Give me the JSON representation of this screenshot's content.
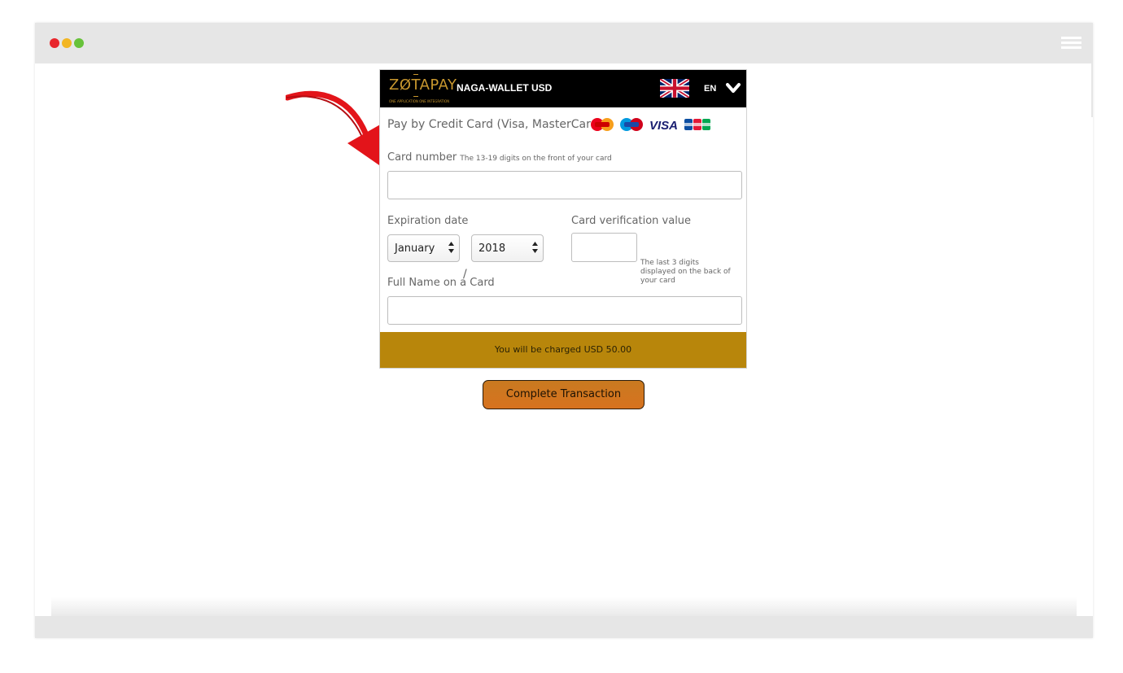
{
  "brand": {
    "logo_text": "ZØTAPAY",
    "logo_tagline": "ONE APPLICATION ONE INTEGRATION",
    "merchant": "NAGA-WALLET USD",
    "language": "EN"
  },
  "payment": {
    "title": "Pay by Credit Card (Visa, MasterCard)",
    "card_logos": [
      "MasterCard",
      "Maestro",
      "VISA",
      "JCB"
    ],
    "card_number_label": "Card number",
    "card_number_hint": "The 13-19 digits on the front of your card",
    "expiration_label": "Expiration date",
    "exp_month": "January",
    "exp_year": "2018",
    "date_separator": "/",
    "cvv_label": "Card verification value",
    "cvv_hint": "The last 3 digits displayed on the back of your card",
    "name_label": "Full Name on a Card",
    "charge_text": "You will be charged USD 50.00",
    "complete_button": "Complete Transaction"
  },
  "colors": {
    "header_bg": "#000000",
    "accent_gold": "#b8860b",
    "button_orange": "#d0751f",
    "arrow_red": "#e3141a"
  }
}
